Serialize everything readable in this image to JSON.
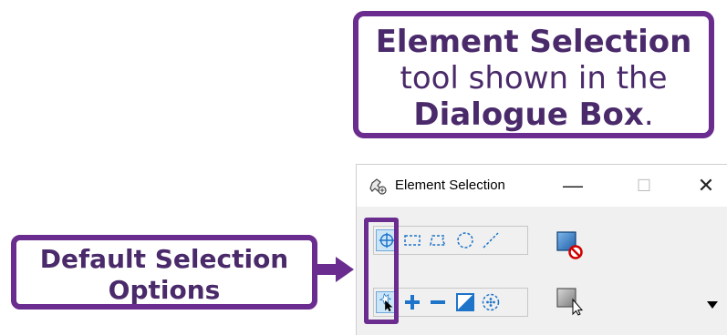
{
  "callout_top": {
    "line1_bold": "Element Selection",
    "line2": "tool shown in the",
    "line3_bold": "Dialogue Box",
    "line3_end": "."
  },
  "callout_left": {
    "line1": "Default Selection",
    "line2": "Options"
  },
  "dialog": {
    "title": "Element Selection",
    "controls": {
      "minimize": "—",
      "maximize": "☐",
      "close": "✕"
    }
  },
  "icons": {
    "app": "element-selection-app-icon",
    "row1": [
      "individual-method-icon",
      "block-method-icon",
      "shape-method-icon",
      "circle-method-icon",
      "line-method-icon"
    ],
    "row2": [
      "new-mode-icon",
      "add-mode-icon",
      "subtract-mode-icon",
      "invert-mode-icon",
      "clear-mode-icon"
    ],
    "side": [
      "clear-selection-icon",
      "select-all-icon"
    ]
  },
  "colors": {
    "callout_border": "#6a2c8e",
    "callout_text": "#4a2a6a",
    "accent_blue": "#1e74c9",
    "stop_red": "#d00000"
  }
}
